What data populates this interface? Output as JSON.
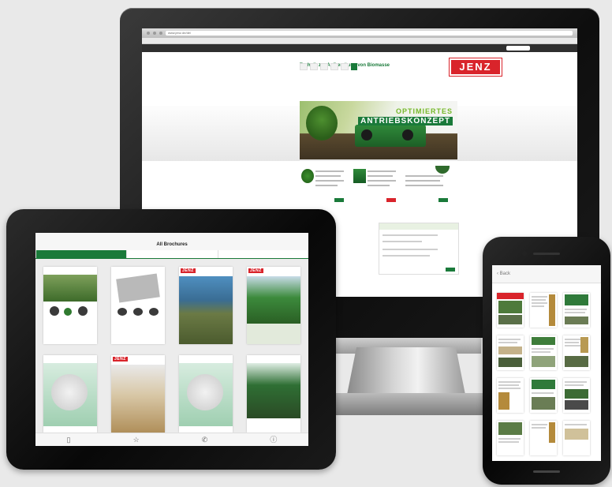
{
  "monitor": {
    "url": "www.jenz.de/de/",
    "site": {
      "tagline": "Technik zur Aufbereitung von Biomasse",
      "logo": "JENZ",
      "hero_line1": "OPTIMIERTES",
      "hero_line2": "ANTRIEBSKONZEPT"
    }
  },
  "tablet": {
    "title": "All Brochures",
    "tabs": [
      "",
      "",
      ""
    ],
    "brochures": [
      {
        "logo": ""
      },
      {
        "logo": ""
      },
      {
        "logo": "JENZ"
      },
      {
        "logo": "JENZ"
      },
      {
        "logo": ""
      },
      {
        "logo": "JENZ"
      },
      {
        "logo": ""
      },
      {
        "logo": ""
      }
    ],
    "bottom_icons": [
      "book-icon",
      "star-icon",
      "phone-icon",
      "info-icon"
    ]
  },
  "phone": {
    "back_label": "Back"
  },
  "colors": {
    "brand_green": "#1a7a3a",
    "brand_red": "#d9242b",
    "light_green": "#76b82a"
  }
}
